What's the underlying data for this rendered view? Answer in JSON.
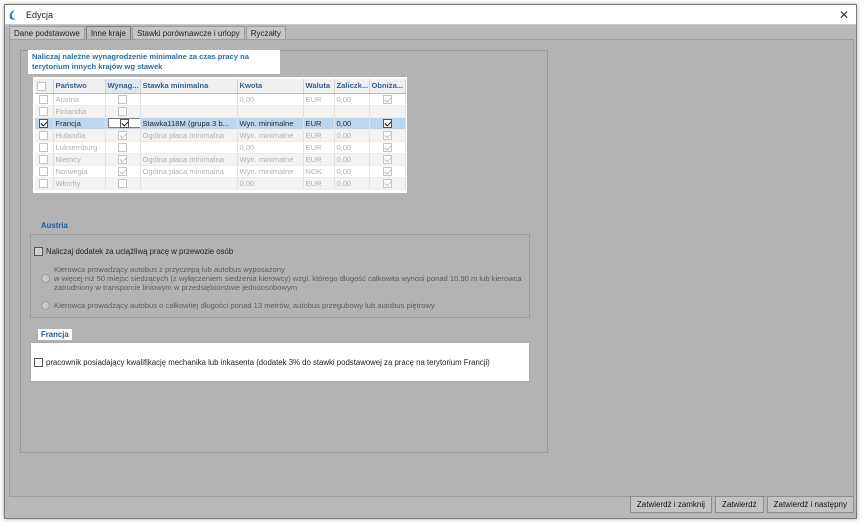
{
  "window": {
    "title": "Edycja",
    "close": "✕"
  },
  "tabs": [
    {
      "label": "Dane podstawowe"
    },
    {
      "label": "Inne kraje"
    },
    {
      "label": "Stawki porównawcze i urlopy"
    },
    {
      "label": "Ryczałty"
    }
  ],
  "notice": "Naliczaj należne wynagrodzenie minimalne za czas pracy na terytorium innych krajów wg stawek",
  "grid": {
    "columns": [
      "",
      "Państwo",
      "Wynag...",
      "Stawka minimalna",
      "Kwota",
      "Waluta",
      "Zaliczk...",
      "Obniża..."
    ],
    "rows": [
      {
        "country": "Austria",
        "rate": "",
        "amount": "0,00",
        "currency": "EUR",
        "advance": "0,00"
      },
      {
        "country": "Finlandia",
        "rate": "",
        "amount": "",
        "currency": "",
        "advance": ""
      },
      {
        "country": "Francja",
        "rate": "Stawka118M (grupa 3 b...",
        "amount": "Wyn. minimalne",
        "currency": "EUR",
        "advance": "0,00"
      },
      {
        "country": "Hulandia",
        "rate": "Ogólna płaca minimalna",
        "amount": "Wyn. minimalne",
        "currency": "EUR",
        "advance": "0,00"
      },
      {
        "country": "Luksemburg",
        "rate": "",
        "amount": "0,00",
        "currency": "EUR",
        "advance": "0,00"
      },
      {
        "country": "Niemcy",
        "rate": "Ogólna płaca minimalna",
        "amount": "Wyn. minimalne",
        "currency": "EUR",
        "advance": "0,00"
      },
      {
        "country": "Norwegia",
        "rate": "Ogólna płaca minimalna",
        "amount": "Wyn. minimalne",
        "currency": "NOK",
        "advance": "0,00"
      },
      {
        "country": "Włochy",
        "rate": "",
        "amount": "0,00",
        "currency": "EUR",
        "advance": "0,00"
      }
    ]
  },
  "austria": {
    "label": "Austria",
    "checkbox": "Naliczaj dodatek za uciążliwą pracę w przewozie osób",
    "radio1": [
      "Kierowca prowadzący autobus z przyczepą lub autobus wyposażony",
      "w więcej niż 50 miejsc siedzących (z wyłączeniem siedzenia kierowcy) wzgl. którego długość całkowita wynosi ponad 10,90 m lub kierowca",
      "zatrudniony w transporcie liniowym w przedsiębiorstwie jednoosobowym"
    ],
    "radio2": "Kierowca prowadzący autobus o całkowitej długości ponad 13 metrów, autobus przegubowy lub autobus piętrowy"
  },
  "francja": {
    "label": "Francja",
    "checkbox": "pracownik posiadający kwalifikację mechanika lub inkasenta (dodatek 3% do stawki podstawowej za pracę na terytorium Francji)"
  },
  "buttons": {
    "approve_close": "Zatwierdź i zamknij",
    "approve": "Zatwierdź",
    "approve_next": "Zatwierdź i następny"
  }
}
